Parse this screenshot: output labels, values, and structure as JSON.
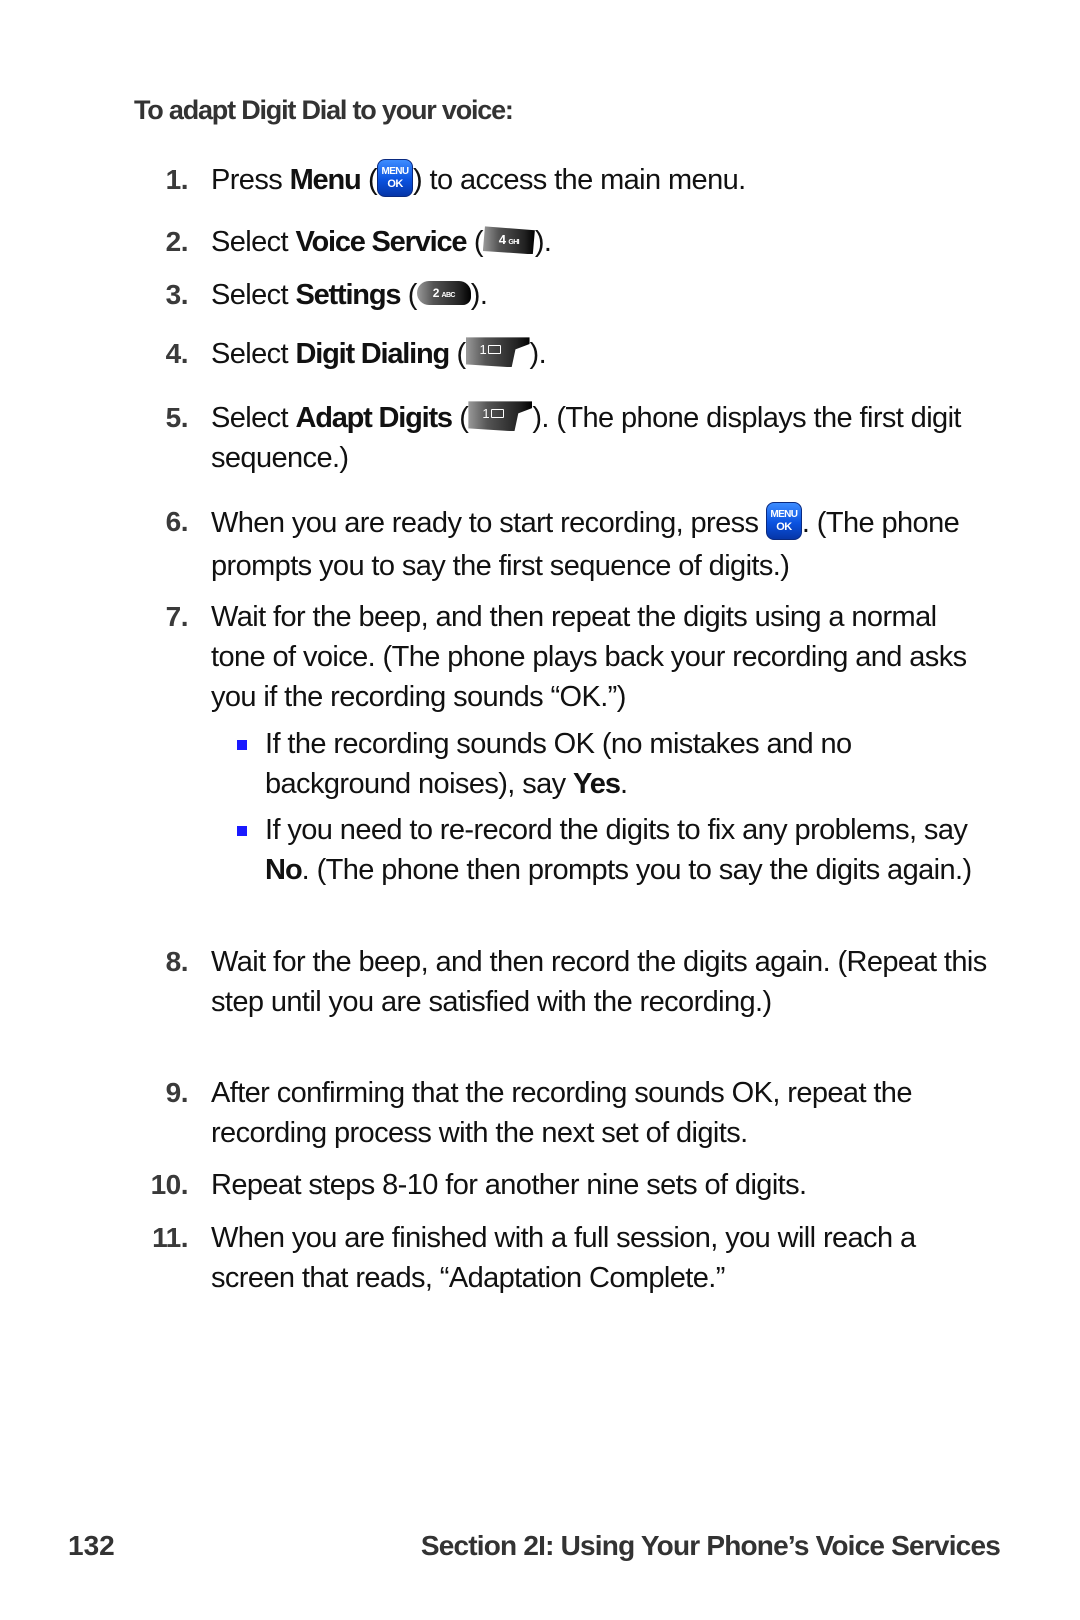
{
  "heading": "To adapt Digit Dial to your voice:",
  "steps": [
    {
      "num": "1.",
      "pre": "Press ",
      "bold": "Menu",
      "mid": " (",
      "icon": "menu-ok-key",
      "icon_label_top": "MENU",
      "icon_label_bottom": "OK",
      "post": ") to access the main menu."
    },
    {
      "num": "2.",
      "pre": "Select ",
      "bold": "Voice Service",
      "mid": " (",
      "icon": "4-ghi-key",
      "icon_digit": "4",
      "icon_letters": "GHI",
      "post": ")."
    },
    {
      "num": "3.",
      "pre": "Select ",
      "bold": "Settings",
      "mid": " (",
      "icon": "2-abc-key",
      "icon_digit": "2",
      "icon_letters": "ABC",
      "post": ")."
    },
    {
      "num": "4.",
      "pre": "Select ",
      "bold": "Digit Dialing",
      "mid": " (",
      "icon": "1-voicemail-key",
      "icon_digit": "1",
      "post": ")."
    },
    {
      "num": "5.",
      "pre": "Select ",
      "bold": "Adapt Digits",
      "mid": " (",
      "icon": "1-voicemail-key",
      "icon_digit": "1",
      "post": "). (The phone displays the first digit sequence.)"
    },
    {
      "num": "6.",
      "pre": "When you are ready to start recording, press ",
      "icon": "menu-ok-key",
      "icon_label_top": "MENU",
      "icon_label_bottom": "OK",
      "post": ". (The phone prompts you to say the first sequence of digits.)"
    },
    {
      "num": "7.",
      "text": "Wait for the beep, and then repeat the digits using a normal tone of voice. (The phone plays back your recording and asks you if the recording sounds “OK.”)",
      "bullets": [
        {
          "pre": "If the recording sounds OK (no mistakes and no background noises), say ",
          "bold": "Yes",
          "post": "."
        },
        {
          "pre": "If you need to re-record the digits to fix any problems, say ",
          "bold": "No",
          "post": ". (The phone then prompts you to say the digits again.)"
        }
      ]
    },
    {
      "num": "8.",
      "text": "Wait for the beep, and then record the digits again. (Repeat this step until you are satisfied with the recording.)"
    },
    {
      "num": "9.",
      "text": "After confirming that the recording sounds OK, repeat the recording process with the next set of digits."
    },
    {
      "num": "10.",
      "text": "Repeat steps 8-10 for another nine sets of digits."
    },
    {
      "num": "11.",
      "text": "When you are finished with a full session, you will reach a screen that reads, “Adaptation Complete.”"
    }
  ],
  "footer": {
    "page_number": "132",
    "section_title": "Section 2I: Using Your Phone’s Voice Services"
  },
  "colors": {
    "bullet": "#1a1aff",
    "menu_key": "#0a52e0",
    "heading": "#333333"
  }
}
